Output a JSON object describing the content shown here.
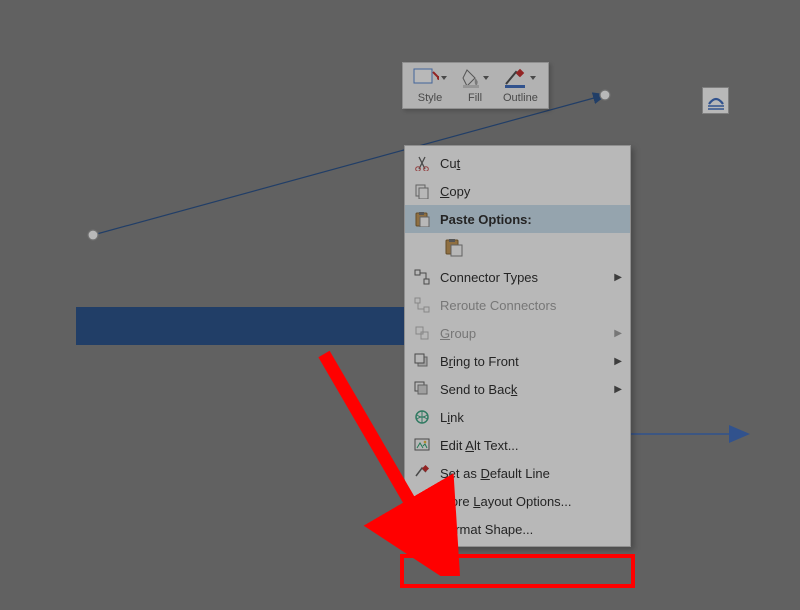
{
  "toolbar": {
    "style_label": "Style",
    "fill_label": "Fill",
    "outline_label": "Outline"
  },
  "context_menu": {
    "cut": "Cut",
    "cut_u": "t",
    "copy": "Copy",
    "copy_u": "C",
    "paste_header": "Paste Options:",
    "connector_types": "Connector Types",
    "reroute": "Reroute Connectors",
    "group": "Group",
    "bring_to_front": "Bring to Front",
    "send_to_back": "Send to Back",
    "link": "Link",
    "edit_alt_text": "Edit Alt Text...",
    "set_default_line": "Set as Default Line",
    "more_layout": "More Layout Options...",
    "format_shape": "Format Shape..."
  },
  "colors": {
    "blue": "#2f568f",
    "accent": "#4472c4",
    "red": "#ff0000"
  }
}
